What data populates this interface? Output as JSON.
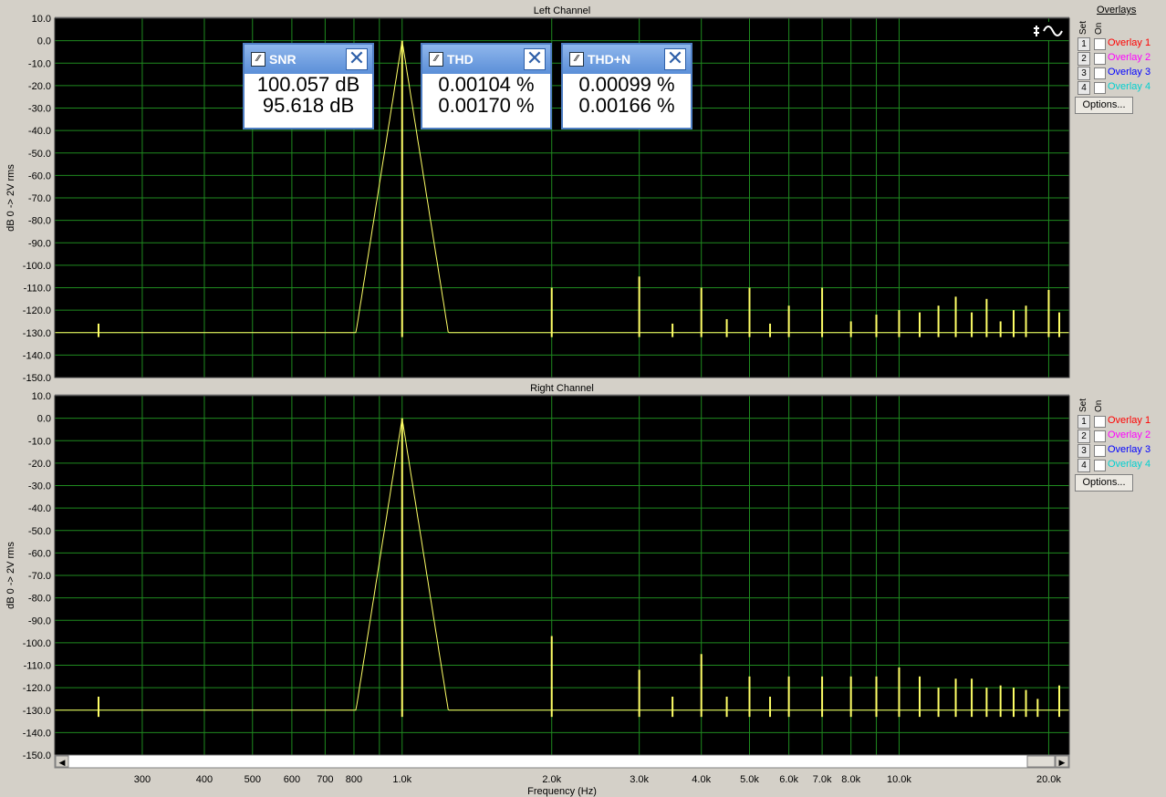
{
  "chart_data": [
    {
      "type": "line",
      "title": "Left Channel",
      "ylabel": "dB 0 -> 2V rms",
      "xlabel": "Frequency (Hz)",
      "xscale": "log",
      "xlim": [
        200,
        22000
      ],
      "ylim": [
        -150,
        10
      ],
      "yticks": [
        10,
        0,
        -10,
        -20,
        -30,
        -40,
        -50,
        -60,
        -70,
        -80,
        -90,
        -100,
        -110,
        -120,
        -130,
        -140,
        -150
      ],
      "grid": true,
      "series": [
        {
          "color": "#ffff66",
          "noise_floor": -132,
          "peaks": [
            [
              245,
              -126
            ],
            [
              1000,
              0
            ],
            [
              2000,
              -110
            ],
            [
              3000,
              -105
            ],
            [
              3500,
              -126
            ],
            [
              4000,
              -110
            ],
            [
              4500,
              -124
            ],
            [
              5000,
              -110
            ],
            [
              5500,
              -126
            ],
            [
              6000,
              -118
            ],
            [
              7000,
              -110
            ],
            [
              8000,
              -125
            ],
            [
              9000,
              -122
            ],
            [
              10000,
              -120
            ],
            [
              11000,
              -121
            ],
            [
              12000,
              -118
            ],
            [
              13000,
              -114
            ],
            [
              14000,
              -121
            ],
            [
              15000,
              -115
            ],
            [
              16000,
              -125
            ],
            [
              17000,
              -120
            ],
            [
              18000,
              -118
            ],
            [
              20000,
              -111
            ],
            [
              21000,
              -121
            ]
          ]
        }
      ]
    },
    {
      "type": "line",
      "title": "Right Channel",
      "ylabel": "dB 0 -> 2V rms",
      "xlabel": "Frequency (Hz)",
      "xscale": "log",
      "xlim": [
        200,
        22000
      ],
      "ylim": [
        -150,
        10
      ],
      "yticks": [
        10,
        0,
        -10,
        -20,
        -30,
        -40,
        -50,
        -60,
        -70,
        -80,
        -90,
        -100,
        -110,
        -120,
        -130,
        -140,
        -150
      ],
      "grid": true,
      "series": [
        {
          "color": "#ffff66",
          "noise_floor": -133,
          "peaks": [
            [
              245,
              -124
            ],
            [
              1000,
              0
            ],
            [
              2000,
              -97
            ],
            [
              3000,
              -112
            ],
            [
              3500,
              -124
            ],
            [
              4000,
              -105
            ],
            [
              4500,
              -124
            ],
            [
              5000,
              -115
            ],
            [
              5500,
              -124
            ],
            [
              6000,
              -115
            ],
            [
              7000,
              -115
            ],
            [
              8000,
              -115
            ],
            [
              9000,
              -115
            ],
            [
              10000,
              -111
            ],
            [
              11000,
              -115
            ],
            [
              12000,
              -120
            ],
            [
              13000,
              -116
            ],
            [
              14000,
              -116
            ],
            [
              15000,
              -120
            ],
            [
              16000,
              -119
            ],
            [
              17000,
              -120
            ],
            [
              18000,
              -121
            ],
            [
              19000,
              -125
            ],
            [
              21000,
              -119
            ]
          ]
        }
      ]
    }
  ],
  "xticks": [
    {
      "f": 300,
      "label": "300"
    },
    {
      "f": 400,
      "label": "400"
    },
    {
      "f": 500,
      "label": "500"
    },
    {
      "f": 600,
      "label": "600"
    },
    {
      "f": 700,
      "label": "700"
    },
    {
      "f": 800,
      "label": "800"
    },
    {
      "f": 1000,
      "label": "1.0k"
    },
    {
      "f": 2000,
      "label": "2.0k"
    },
    {
      "f": 3000,
      "label": "3.0k"
    },
    {
      "f": 4000,
      "label": "4.0k"
    },
    {
      "f": 5000,
      "label": "5.0k"
    },
    {
      "f": 6000,
      "label": "6.0k"
    },
    {
      "f": 7000,
      "label": "7.0k"
    },
    {
      "f": 8000,
      "label": "8.0k"
    },
    {
      "f": 10000,
      "label": "10.0k"
    },
    {
      "f": 20000,
      "label": "20.0k"
    }
  ],
  "meters": {
    "snr": {
      "title": "SNR",
      "v1": "100.057 dB",
      "v2": "95.618 dB"
    },
    "thd": {
      "title": "THD",
      "v1": "0.00104 %",
      "v2": "0.00170 %"
    },
    "thdn": {
      "title": "THD+N",
      "v1": "0.00099 %",
      "v2": "0.00166 %"
    }
  },
  "overlays": {
    "title": "Overlays",
    "set_label": "Set",
    "on_label": "On",
    "options_label": "Options...",
    "items": [
      {
        "num": "1",
        "label": "Overlay 1",
        "color": "#ff0000"
      },
      {
        "num": "2",
        "label": "Overlay 2",
        "color": "#ff00ff"
      },
      {
        "num": "3",
        "label": "Overlay 3",
        "color": "#0000ff"
      },
      {
        "num": "4",
        "label": "Overlay 4",
        "color": "#00e0e0"
      }
    ]
  }
}
